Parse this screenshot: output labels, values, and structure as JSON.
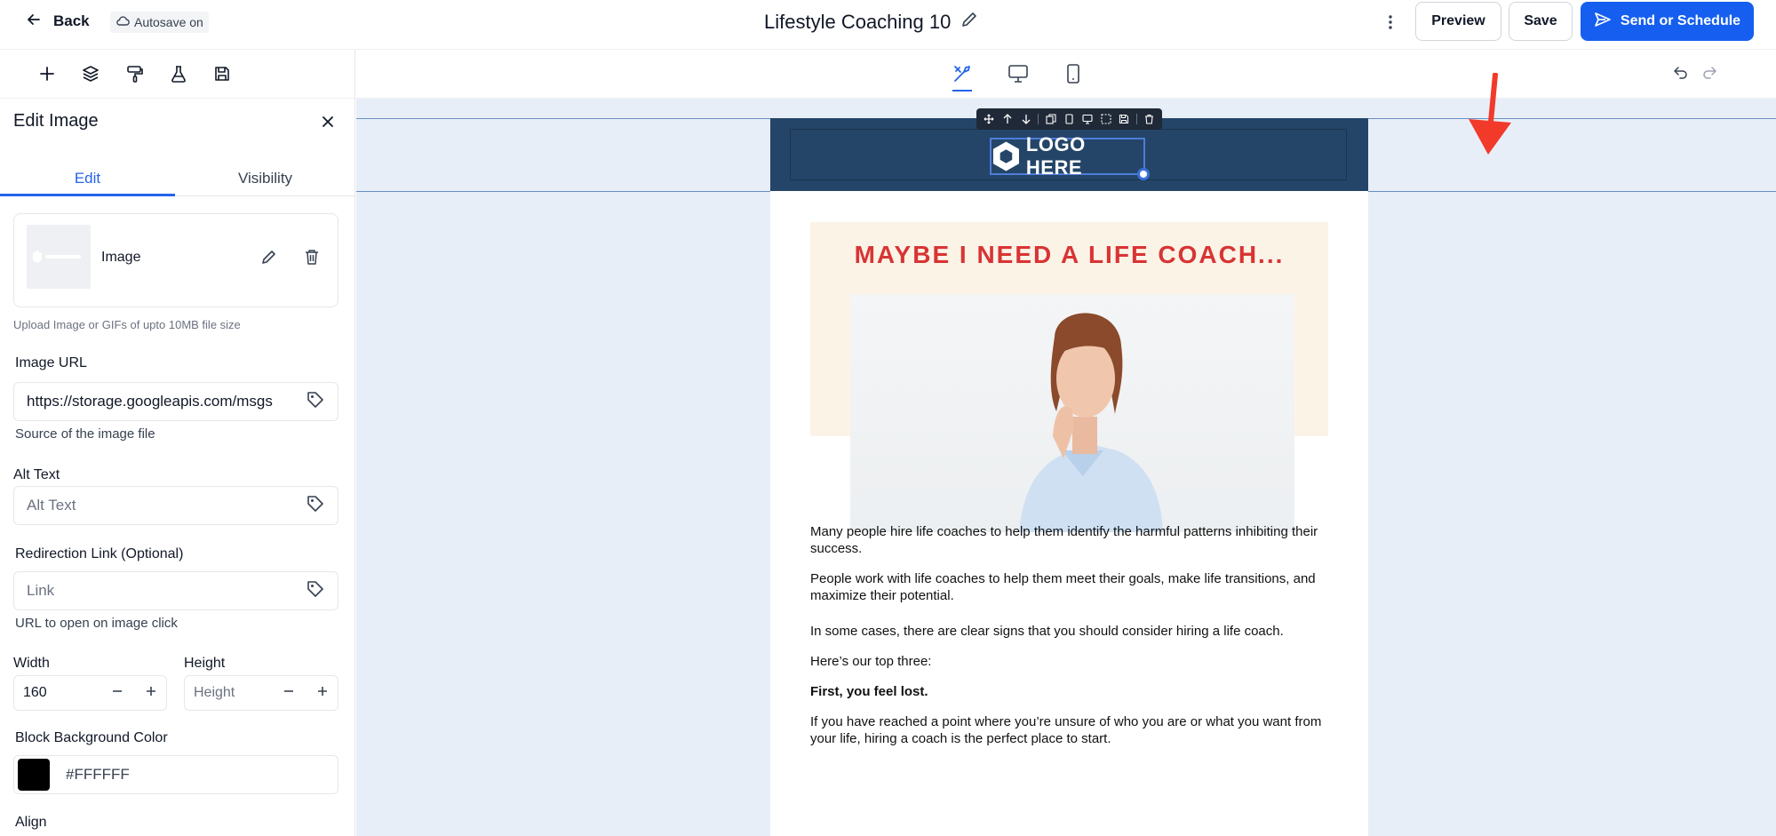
{
  "header": {
    "back_label": "Back",
    "autosave_label": "Autosave on",
    "title": "Lifestyle Coaching 10",
    "preview_label": "Preview",
    "save_label": "Save",
    "send_label": "Send or Schedule",
    "accent_color": "#155eef"
  },
  "left_tools": [
    "plus-icon",
    "layers-icon",
    "paint-roller-icon",
    "flask-icon",
    "save-icon"
  ],
  "panel": {
    "title": "Edit Image",
    "tabs": [
      {
        "label": "Edit",
        "active": true
      },
      {
        "label": "Visibility",
        "active": false
      }
    ],
    "image_card": {
      "label": "Image"
    },
    "upload_help": "Upload Image or GIFs of upto 10MB file size",
    "image_url": {
      "label": "Image URL",
      "value": "https://storage.googleapis.com/msgs",
      "help": "Source of the image file"
    },
    "alt_text": {
      "label": "Alt Text",
      "placeholder": "Alt Text"
    },
    "redirect": {
      "label": "Redirection Link (Optional)",
      "placeholder": "Link",
      "help": "URL to open on image click"
    },
    "width": {
      "label": "Width",
      "value": "160"
    },
    "height": {
      "label": "Height",
      "placeholder": "Height"
    },
    "bg_color": {
      "label": "Block Background Color",
      "value": "#FFFFFF",
      "swatch": "#000000"
    },
    "align": {
      "label": "Align"
    }
  },
  "canvas": {
    "devices": [
      "tools-icon",
      "desktop-icon",
      "mobile-icon"
    ],
    "email": {
      "logo_text": "LOGO HERE",
      "headline": "MAYBE I NEED A LIFE COACH...",
      "paragraphs": [
        {
          "text": "Many people hire life coaches to help them identify the harmful patterns inhibiting their success.",
          "bold": false
        },
        {
          "text": "People work with life coaches to help them meet their goals, make life transitions, and maximize their potential.",
          "bold": false
        },
        {
          "text": "In some cases, there are clear signs that you should consider hiring a life coach.",
          "bold": false
        },
        {
          "text": "Here’s our top three:",
          "bold": false
        },
        {
          "text": "First, you feel lost.",
          "bold": true
        },
        {
          "text": "If you have reached a point where you’re unsure of who you are or what you want from your life, hiring a coach is the perfect place to start.",
          "bold": false
        }
      ]
    }
  }
}
